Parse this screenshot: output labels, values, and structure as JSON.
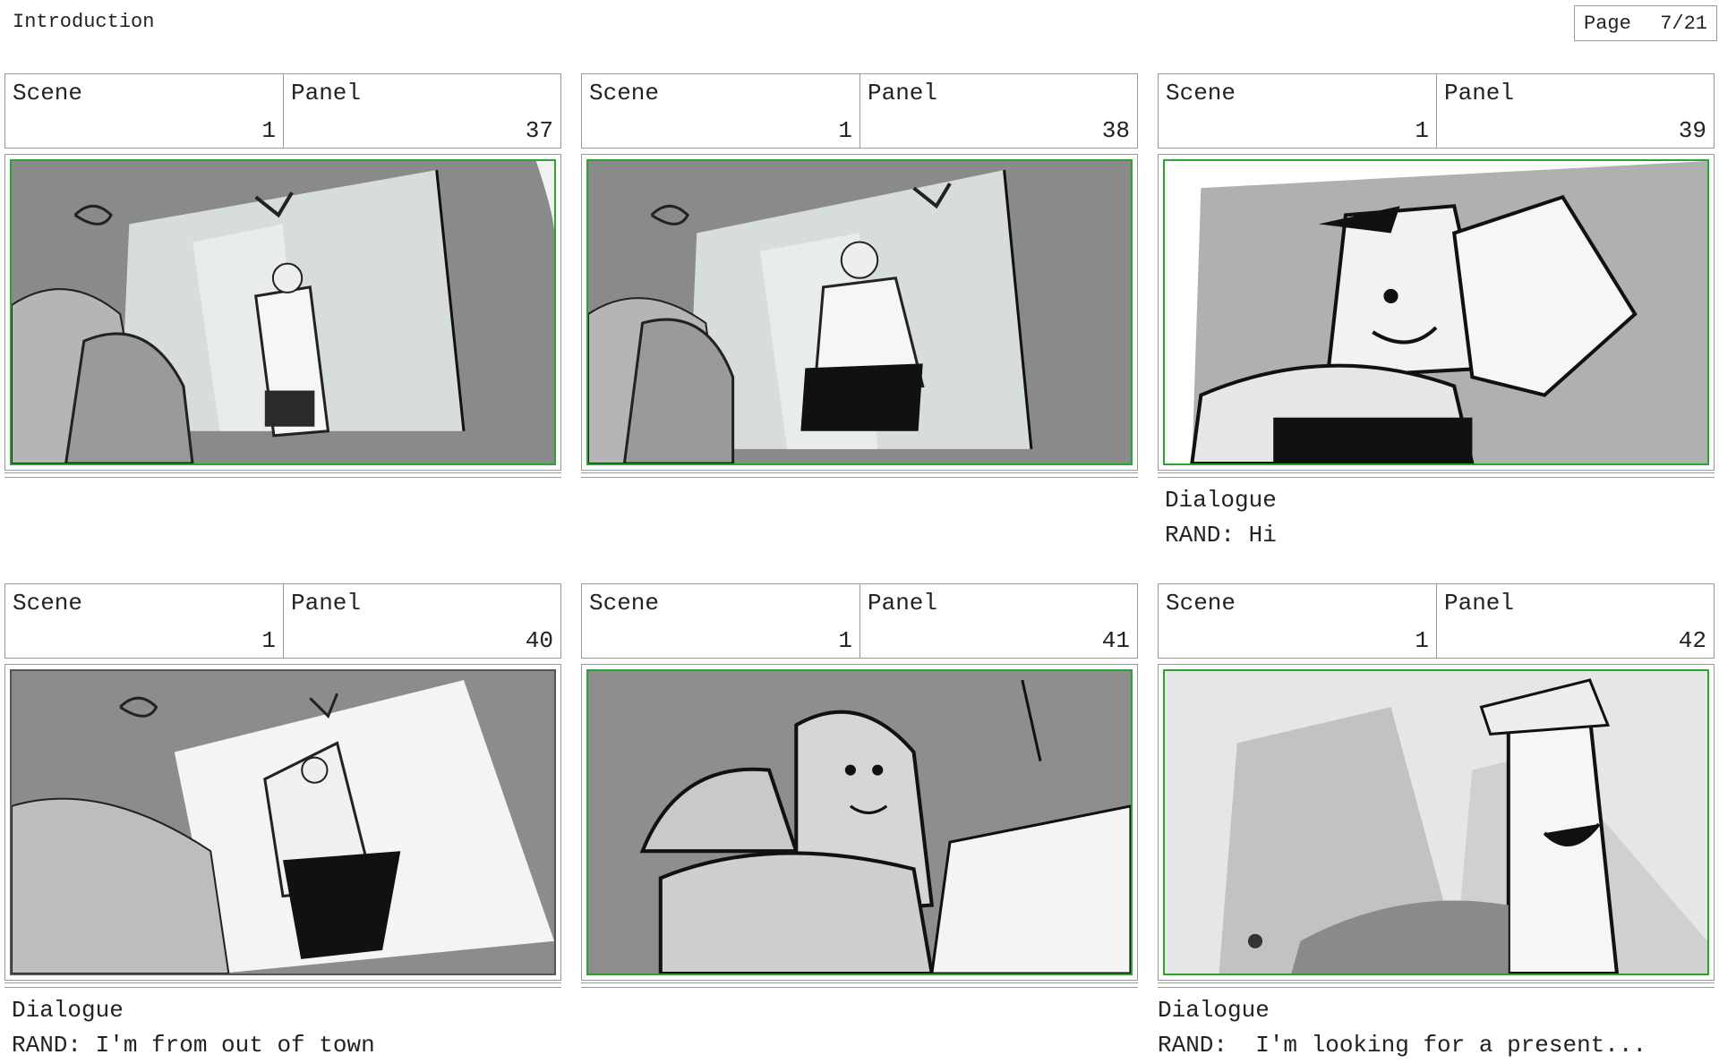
{
  "header": {
    "title": "Introduction",
    "page_label": "Page",
    "page_value": "7/21"
  },
  "labels": {
    "scene": "Scene",
    "panel": "Panel",
    "dialogue": "Dialogue"
  },
  "panels": [
    {
      "scene": "1",
      "panel": "37",
      "dialogue": ""
    },
    {
      "scene": "1",
      "panel": "38",
      "dialogue": ""
    },
    {
      "scene": "1",
      "panel": "39",
      "dialogue": "RAND: Hi"
    },
    {
      "scene": "1",
      "panel": "40",
      "dialogue": "RAND: I'm from out of town"
    },
    {
      "scene": "1",
      "panel": "41",
      "dialogue": ""
    },
    {
      "scene": "1",
      "panel": "42",
      "dialogue": "RAND:  I'm looking for a present..."
    }
  ]
}
